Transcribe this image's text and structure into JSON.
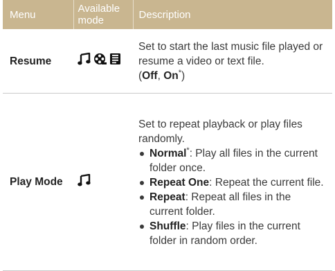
{
  "headers": {
    "menu": "Menu",
    "mode_line1": "Available",
    "mode_line2": "mode",
    "description": "Description"
  },
  "rows": [
    {
      "menu": "Resume",
      "icons": [
        "music-icon",
        "video-icon",
        "text-icon"
      ],
      "desc": "Set to start the last music file played or resume a video or text file.",
      "options_open": "(",
      "opt1": "Off",
      "sep": ", ",
      "opt2": "On",
      "star": "*",
      "options_close": ")"
    },
    {
      "menu": "Play Mode",
      "icons": [
        "music-icon"
      ],
      "desc": "Set to repeat playback or play files randomly.",
      "bullets": [
        {
          "term": "Normal",
          "star": "*",
          "text": ": Play all files in the current folder once."
        },
        {
          "term": "Repeat One",
          "star": "",
          "text": ": Repeat the current file."
        },
        {
          "term": "Repeat",
          "star": "",
          "text": ": Repeat all files in the current folder."
        },
        {
          "term": "Shuffle",
          "star": "",
          "text": ": Play files in the current folder in random order."
        }
      ]
    }
  ]
}
